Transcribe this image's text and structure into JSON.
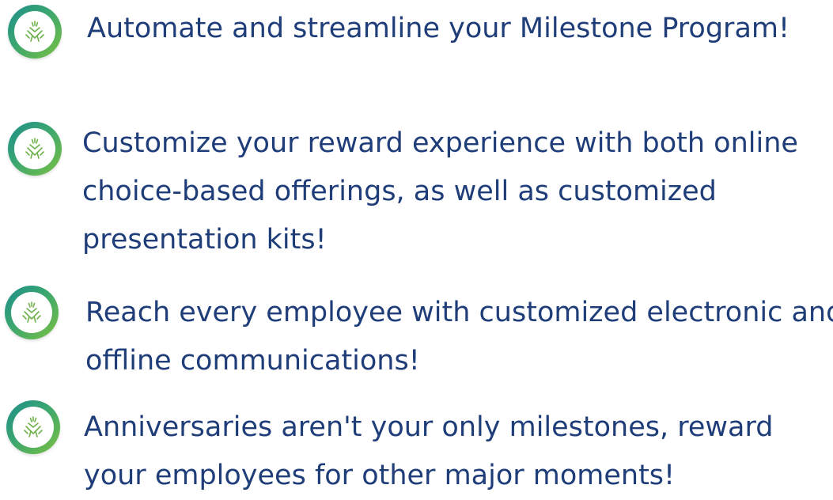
{
  "colors": {
    "text": "#1f3d78",
    "badge_gradient_start": "#1f8f8c",
    "badge_gradient_end": "#7cc142",
    "icon_stroke": "#6fb24c"
  },
  "features": [
    {
      "icon": "joined-hands-icon",
      "lines": [
        "Automate and streamline your Milestone Program!"
      ]
    },
    {
      "icon": "joined-hands-icon",
      "lines": [
        "Customize your reward experience with both online",
        "choice-based offerings, as well as customized",
        "presentation kits!"
      ]
    },
    {
      "icon": "joined-hands-icon",
      "lines": [
        "Reach every employee with customized electronic and",
        "offline communications!"
      ]
    },
    {
      "icon": "joined-hands-icon",
      "lines": [
        "Anniversaries aren't your only milestones, reward",
        "your employees for other major moments!"
      ]
    }
  ]
}
